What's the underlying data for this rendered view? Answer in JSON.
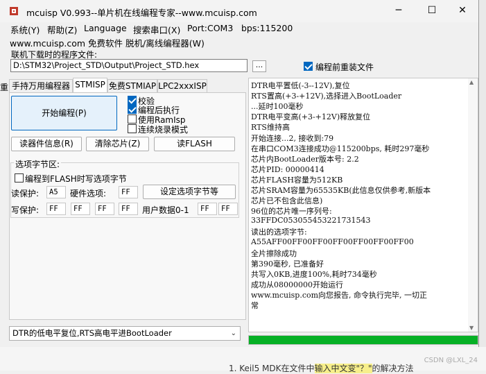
{
  "window": {
    "title": "mcuisp V0.993--单片机在线编程专家--www.mcuisp.com",
    "minimize": "─",
    "maximize": "☐",
    "close": "✕"
  },
  "menu": {
    "items": [
      "系统(Y)",
      "帮助(Z)",
      "Language",
      "搜索串口(X)",
      "Port:COM3",
      "bps:115200"
    ]
  },
  "submenu_text": "www.mcuisp.com 免费软件 脱机/离线编程器(W)",
  "program_file": {
    "label": "联机下载时的程序文件:",
    "path": "D:\\STM32\\Project_STD\\Output\\Project_STD.hex",
    "browse": "...",
    "reload_label": "编程前重装文件",
    "reload_checked": true
  },
  "tabs": [
    "手持万用编程器",
    "STMISP",
    "免费STMIAP",
    "LPC2xxxISP"
  ],
  "tab_edge": "重",
  "stmisp": {
    "start_button": "开始编程(P)",
    "options": [
      {
        "label": "校验",
        "checked": true
      },
      {
        "label": "编程后执行",
        "checked": true
      },
      {
        "label": "使用RamIsp",
        "checked": false
      },
      {
        "label": "连续烧录模式",
        "checked": false
      }
    ],
    "read_info": "读器件信息(R)",
    "clear_chip": "清除芯片(Z)",
    "read_flash": "读FLASH",
    "option_group": {
      "title": "选项字节区:",
      "write_to_flash": "编程到FLASH时写选项字节",
      "write_to_flash_checked": false,
      "read_protect_label": "读保护:",
      "read_protect": "A5",
      "hw_option_label": "硬件选项:",
      "hw_option": "FF",
      "set_option_button": "设定选项字节等",
      "write_protect_label": "写保护:",
      "write_protect": [
        "FF",
        "FF",
        "FF",
        "FF"
      ],
      "user_data_label": "用户数据0-1",
      "user_data": [
        "FF",
        "FF"
      ]
    },
    "boot_mode": "DTR的低电平复位,RTS高电平进BootLoader"
  },
  "log": [
    "DTR电平置低(-3--12V),复位",
    "RTS置高(+3-+12V),选择进入BootLoader",
    "...延时100毫秒",
    "DTR电平变高(+3-+12V)释放复位",
    "RTS维持高",
    "开始连接...2, 接收到:79",
    "在串口COM3连接成功@115200bps, 耗时297毫秒",
    "芯片内BootLoader版本号: 2.2",
    "芯片PID: 00000414",
    "芯片FLASH容量为512KB",
    "芯片SRAM容量为65535KB(此信息仅供参考,新版本",
    "芯片已不包含此信息)",
    "96位的芯片唯一序列号:",
    "33FFDC053055453221731543",
    "读出的选项字节:",
    "A55AFF00FF00FF00FF00FF00FF00FF00",
    "全片擦除成功",
    "第390毫秒, 已准备好",
    "共写入0KB,进度100%,耗时734毫秒",
    "成功从08000000开始运行",
    "www.mcuisp.com向您报告, 命令执行完毕, 一切正",
    "常"
  ],
  "progress_percent": 100,
  "colors": {
    "progress": "#06b025",
    "accent": "#0067c0"
  },
  "background": {
    "footer_text": "1. Keil5 MDK在文件中",
    "footer_highlight": "输入中文变\"？\"",
    "footer_tail": "的解决方法",
    "watermark": "CSDN @LXL_24"
  }
}
